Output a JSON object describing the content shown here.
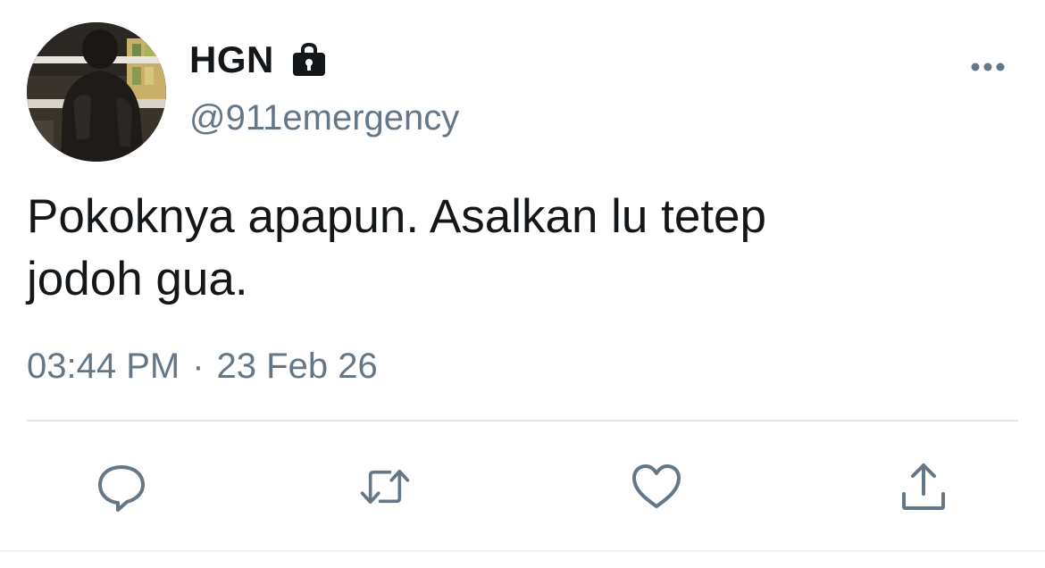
{
  "author": {
    "display_name": "HGN",
    "handle": "@911emergency",
    "protected_icon": "lock-icon",
    "avatar": "profile-photo"
  },
  "tweet": {
    "text_line1": "Pokoknya apapun. Asalkan lu tetep",
    "text_line2": "jodoh gua.",
    "time": "03:44 PM",
    "separator": "·",
    "date": "23 Feb 26"
  },
  "actions": {
    "reply_icon": "reply-bubble-icon",
    "retweet_icon": "retweet-icon",
    "like_icon": "heart-icon",
    "share_icon": "share-upload-icon",
    "more_icon": "more-dots-icon"
  },
  "colors": {
    "text_primary": "#14171a",
    "text_secondary": "#657786",
    "divider": "#e1e8ed"
  }
}
